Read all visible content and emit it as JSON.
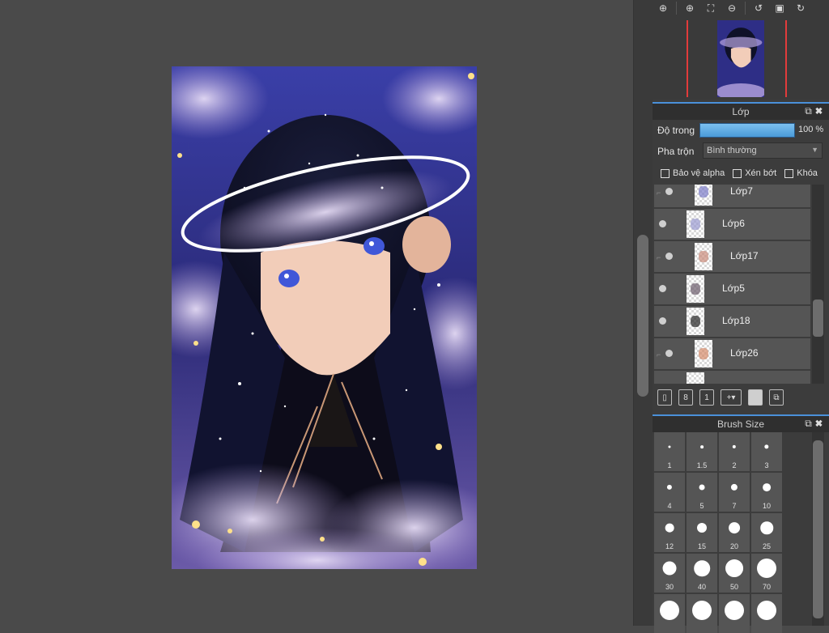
{
  "navigator": {
    "buttons": [
      {
        "name": "zoom-actual-icon",
        "glyph": "⊕"
      },
      {
        "name": "zoom-in-icon",
        "glyph": "⊕"
      },
      {
        "name": "fit-window-icon",
        "glyph": "⛶"
      },
      {
        "name": "zoom-out-icon",
        "glyph": "⊖"
      },
      {
        "name": "rotate-left-icon",
        "glyph": "↺"
      },
      {
        "name": "flip-icon",
        "glyph": "▣"
      },
      {
        "name": "rotate-right-icon",
        "glyph": "↻"
      }
    ]
  },
  "layers_panel": {
    "title": "Lớp",
    "opacity_label": "Độ trong",
    "opacity_value": "100 %",
    "opacity_fraction": 1.0,
    "blend_label": "Pha trộn",
    "blend_value": "Bình thường",
    "checkboxes": [
      {
        "label": "Bảo vệ alpha",
        "checked": false
      },
      {
        "label": "Xén bớt",
        "checked": false
      },
      {
        "label": "Khóa",
        "checked": false
      }
    ],
    "layers": [
      {
        "name": "Lớp7",
        "clipped": true
      },
      {
        "name": "Lớp6",
        "clipped": false
      },
      {
        "name": "Lớp17",
        "clipped": true
      },
      {
        "name": "Lớp5",
        "clipped": false
      },
      {
        "name": "Lớp18",
        "clipped": false
      },
      {
        "name": "Lớp26",
        "clipped": true
      }
    ]
  },
  "brush_panel": {
    "title": "Brush Size",
    "sizes": [
      "1",
      "1.5",
      "2",
      "3",
      "4",
      "5",
      "7",
      "10",
      "12",
      "15",
      "20",
      "25",
      "30",
      "40",
      "50",
      "70",
      "",
      "",
      "",
      ""
    ]
  },
  "colors": {
    "accent": "#4a90d9",
    "panel_bg": "#3c3c3c",
    "layer_bg": "#555555",
    "workspace_bg": "#4a4a4a"
  }
}
